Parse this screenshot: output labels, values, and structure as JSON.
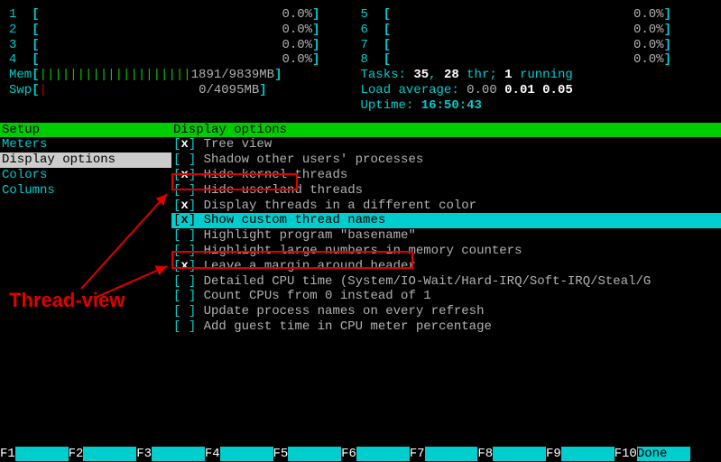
{
  "cpus_left": [
    {
      "n": "1",
      "bar": "[",
      "val": "0.0%",
      "close": "]"
    },
    {
      "n": "2",
      "bar": "[",
      "val": "0.0%",
      "close": "]"
    },
    {
      "n": "3",
      "bar": "[",
      "val": "0.0%",
      "close": "]"
    },
    {
      "n": "4",
      "bar": "[",
      "val": "0.0%",
      "close": "]"
    }
  ],
  "cpus_right": [
    {
      "n": "5",
      "bar": "[",
      "val": "0.0%",
      "close": "]"
    },
    {
      "n": "6",
      "bar": "[",
      "val": "0.0%",
      "close": "]"
    },
    {
      "n": "7",
      "bar": "[",
      "val": "0.0%",
      "close": "]"
    },
    {
      "n": "8",
      "bar": "[",
      "val": "0.0%",
      "close": "]"
    }
  ],
  "mem": {
    "label": "Mem",
    "bar": "||||||||||||||||||||",
    "used": "1891/9839MB"
  },
  "swp": {
    "label": "Swp",
    "bar": "|",
    "used": "0/4095MB"
  },
  "tasks": {
    "label": "Tasks:",
    "procs": "35",
    "sep1": ",",
    "thr": "28",
    "thr_label": "thr;",
    "run": "1",
    "run_label": "running"
  },
  "load": {
    "label": "Load average:",
    "a1": "0.00",
    "a5": "0.01",
    "a15": "0.05"
  },
  "uptime": {
    "label": "Uptime:",
    "val": "16:50:43"
  },
  "menu": {
    "header": "Setup",
    "items": [
      "Meters",
      "Display options",
      "Colors",
      "Columns"
    ],
    "selected_index": 1
  },
  "options": {
    "header": "Display options",
    "selected_index": 5,
    "list": [
      {
        "checked": true,
        "label": "Tree view"
      },
      {
        "checked": false,
        "label": "Shadow other users' processes"
      },
      {
        "checked": true,
        "label": "Hide kernel threads"
      },
      {
        "checked": false,
        "label": "Hide userland threads"
      },
      {
        "checked": true,
        "label": "Display threads in a different color"
      },
      {
        "checked": true,
        "label": "Show custom thread names"
      },
      {
        "checked": false,
        "label": "Highlight program \"basename\""
      },
      {
        "checked": false,
        "label": "Highlight large numbers in memory counters"
      },
      {
        "checked": true,
        "label": "Leave a margin around header"
      },
      {
        "checked": false,
        "label": "Detailed CPU time (System/IO-Wait/Hard-IRQ/Soft-IRQ/Steal/G"
      },
      {
        "checked": false,
        "label": "Count CPUs from 0 instead of 1"
      },
      {
        "checked": false,
        "label": "Update process names on every refresh"
      },
      {
        "checked": false,
        "label": "Add guest time in CPU meter percentage"
      }
    ]
  },
  "fkeys": [
    {
      "key": "F1",
      "label": "    "
    },
    {
      "key": "F2",
      "label": "    "
    },
    {
      "key": "F3",
      "label": "    "
    },
    {
      "key": "F4",
      "label": "    "
    },
    {
      "key": "F5",
      "label": "    "
    },
    {
      "key": "F6",
      "label": "    "
    },
    {
      "key": "F7",
      "label": "    "
    },
    {
      "key": "F8",
      "label": "    "
    },
    {
      "key": "F9",
      "label": "    "
    },
    {
      "key": "F10",
      "label": "Done"
    }
  ],
  "annotation": "Thread-view"
}
